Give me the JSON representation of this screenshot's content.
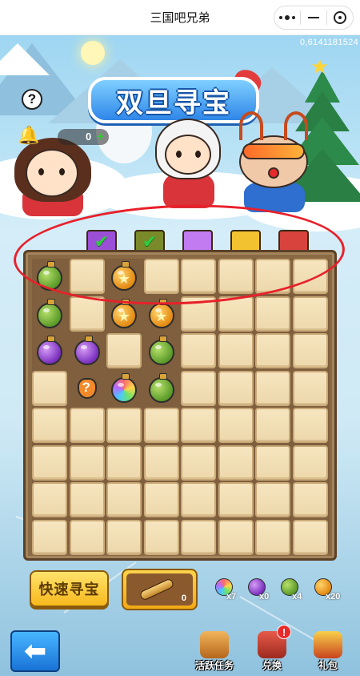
{
  "topbar": {
    "title": "三国吧兄弟"
  },
  "game": {
    "user_id": "0,6141181524",
    "help_label": "?",
    "banner_title": "双旦寻宝",
    "coin_count": "0",
    "coin_plus": "+",
    "tabs": [
      {
        "checked": true,
        "color": "#9b4fd6"
      },
      {
        "checked": true,
        "color": "#7a8a2a"
      },
      {
        "checked": false,
        "color": "#c27bf0"
      },
      {
        "checked": false,
        "color": "#f2c230"
      },
      {
        "checked": false,
        "color": "#d8433e"
      }
    ],
    "board": {
      "rows": 8,
      "cols": 8,
      "items": [
        {
          "row": 0,
          "col": 0,
          "type": "green"
        },
        {
          "row": 0,
          "col": 2,
          "type": "gold"
        },
        {
          "row": 1,
          "col": 0,
          "type": "green"
        },
        {
          "row": 1,
          "col": 2,
          "type": "gold"
        },
        {
          "row": 1,
          "col": 3,
          "type": "gold"
        },
        {
          "row": 2,
          "col": 0,
          "type": "purple"
        },
        {
          "row": 2,
          "col": 1,
          "type": "purple"
        },
        {
          "row": 2,
          "col": 3,
          "type": "green"
        },
        {
          "row": 3,
          "col": 1,
          "type": "mystery"
        },
        {
          "row": 3,
          "col": 2,
          "type": "rainbow"
        },
        {
          "row": 3,
          "col": 3,
          "type": "green"
        }
      ]
    },
    "quick_search_label": "快速寻宝",
    "telescope_count": "0",
    "inventory": [
      {
        "type": "rainbow",
        "count": "x7"
      },
      {
        "type": "purple",
        "count": "x0"
      },
      {
        "type": "green",
        "count": "x4"
      },
      {
        "type": "gold",
        "count": "x20"
      }
    ],
    "bottom_nav": {
      "tasks_label": "活跃任务",
      "exchange_label": "兑换",
      "exchange_badge": "!",
      "gift_label": "礼包"
    }
  }
}
